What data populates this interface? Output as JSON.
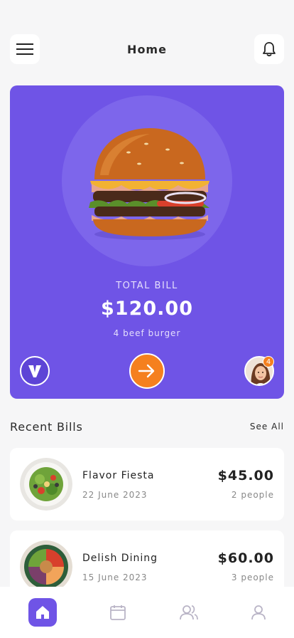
{
  "header": {
    "title": "Home",
    "menu_icon": "hamburger-menu-icon",
    "notification_icon": "bell-icon"
  },
  "hero": {
    "label": "TOTAL BILL",
    "amount": "$120.00",
    "subtitle": "4 beef burger",
    "image": "burger-image",
    "logo_letter": "V",
    "action_icon": "arrow-right-icon",
    "avatar_badge": "4"
  },
  "recent": {
    "title": "Recent Bills",
    "see_all": "See All",
    "items": [
      {
        "name": "Flavor Fiesta",
        "date": "22 June 2023",
        "amount": "$45.00",
        "people": "2 people"
      },
      {
        "name": "Delish Dining",
        "date": "15 June 2023",
        "amount": "$60.00",
        "people": "3 people"
      }
    ]
  },
  "tabbar": {
    "items": [
      "home-icon",
      "calendar-icon",
      "users-icon",
      "profile-icon"
    ],
    "active": "home-icon"
  },
  "colors": {
    "accent": "#6f54e6",
    "orange": "#f5801e",
    "background": "#f6f6f7"
  }
}
